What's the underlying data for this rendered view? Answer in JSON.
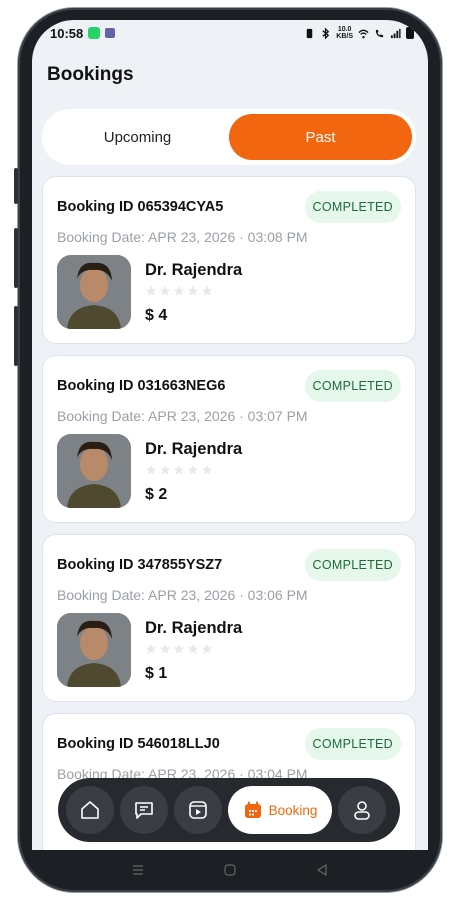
{
  "status_bar": {
    "time": "10:58",
    "net_speed": "10.0\nKB/S"
  },
  "page": {
    "title": "Bookings"
  },
  "tabs": [
    {
      "label": "Upcoming",
      "active": false
    },
    {
      "label": "Past",
      "active": true
    }
  ],
  "bookings": [
    {
      "id": "Booking ID 065394CYA5",
      "status": "COMPLETED",
      "date": "Booking Date: APR 23, 2026 · 03:08 PM",
      "doctor": "Dr. Rajendra",
      "rating": 0,
      "price": "$ 4"
    },
    {
      "id": "Booking ID 031663NEG6",
      "status": "COMPLETED",
      "date": "Booking Date: APR 23, 2026 · 03:07 PM",
      "doctor": "Dr. Rajendra",
      "rating": 0,
      "price": "$ 2"
    },
    {
      "id": "Booking ID 347855YSZ7",
      "status": "COMPLETED",
      "date": "Booking Date: APR 23, 2026 · 03:06 PM",
      "doctor": "Dr. Rajendra",
      "rating": 0,
      "price": "$ 1"
    },
    {
      "id": "Booking ID 546018LLJ0",
      "status": "COMPLETED",
      "date": "Booking Date: APR 23, 2026 · 03:04 PM",
      "doctor": "",
      "rating": 0,
      "price": ""
    }
  ],
  "bottom_nav": {
    "items": [
      {
        "icon": "home-icon"
      },
      {
        "icon": "chat-icon"
      },
      {
        "icon": "video-icon"
      },
      {
        "icon": "calendar-icon",
        "label": "Booking",
        "active": true
      },
      {
        "icon": "profile-icon"
      }
    ]
  },
  "colors": {
    "accent": "#f26610",
    "badge_bg": "#e6f7ec",
    "badge_text": "#1e6b3a",
    "background": "#eef2f7"
  }
}
